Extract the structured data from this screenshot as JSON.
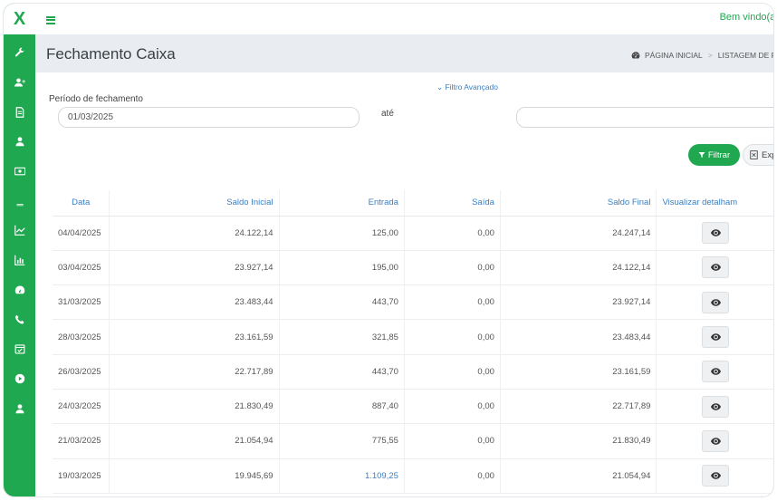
{
  "sidebar": {
    "logo": "X",
    "items": [
      {
        "icon": "wrench-icon"
      },
      {
        "icon": "user-plus-icon"
      },
      {
        "icon": "document-icon"
      },
      {
        "icon": "user-icon"
      },
      {
        "icon": "money-icon"
      },
      {
        "icon": "book-icon"
      },
      {
        "icon": "line-chart-icon"
      },
      {
        "icon": "bar-chart-icon"
      },
      {
        "icon": "dashboard-icon"
      },
      {
        "icon": "phone-icon"
      },
      {
        "icon": "calendar-check-icon"
      },
      {
        "icon": "play-circle-icon"
      },
      {
        "icon": "user-icon"
      }
    ]
  },
  "topbar": {
    "welcome": "Bem vindo(a)"
  },
  "header": {
    "title": "Fechamento Caixa",
    "breadcrumb_home": "PÁGINA INICIAL",
    "breadcrumb_sep": ">",
    "breadcrumb_current": "LISTAGEM DE FECH"
  },
  "filters": {
    "advanced_link": "⌄ Filtro Avançado",
    "period_label": "Período de fechamento",
    "date_from": "01/03/2025",
    "until_label": "até",
    "date_to": "",
    "filter_button": "Filtrar",
    "export_button": "Exp"
  },
  "table": {
    "columns": [
      "Data",
      "Saldo Inicial",
      "Entrada",
      "Saída",
      "Saldo Final",
      "Visualizar detalham"
    ],
    "rows": [
      {
        "data": "04/04/2025",
        "saldo_inicial": "24.122,14",
        "entrada": "125,00",
        "saida": "0,00",
        "saldo_final": "24.247,14"
      },
      {
        "data": "03/04/2025",
        "saldo_inicial": "23.927,14",
        "entrada": "195,00",
        "saida": "0,00",
        "saldo_final": "24.122,14"
      },
      {
        "data": "31/03/2025",
        "saldo_inicial": "23.483,44",
        "entrada": "443,70",
        "saida": "0,00",
        "saldo_final": "23.927,14"
      },
      {
        "data": "28/03/2025",
        "saldo_inicial": "23.161,59",
        "entrada": "321,85",
        "saida": "0,00",
        "saldo_final": "23.483,44"
      },
      {
        "data": "26/03/2025",
        "saldo_inicial": "22.717,89",
        "entrada": "443,70",
        "saida": "0,00",
        "saldo_final": "23.161,59"
      },
      {
        "data": "24/03/2025",
        "saldo_inicial": "21.830,49",
        "entrada": "887,40",
        "saida": "0,00",
        "saldo_final": "22.717,89"
      },
      {
        "data": "21/03/2025",
        "saldo_inicial": "21.054,94",
        "entrada": "775,55",
        "saida": "0,00",
        "saldo_final": "21.830,49"
      },
      {
        "data": "19/03/2025",
        "saldo_inicial": "19.945,69",
        "entrada": "1.109,25",
        "saida": "0,00",
        "saldo_final": "21.054,94"
      }
    ]
  },
  "colors": {
    "brand": "#1fa84f",
    "link": "#3a7fc1",
    "title_bar": "#e9ecf0"
  }
}
